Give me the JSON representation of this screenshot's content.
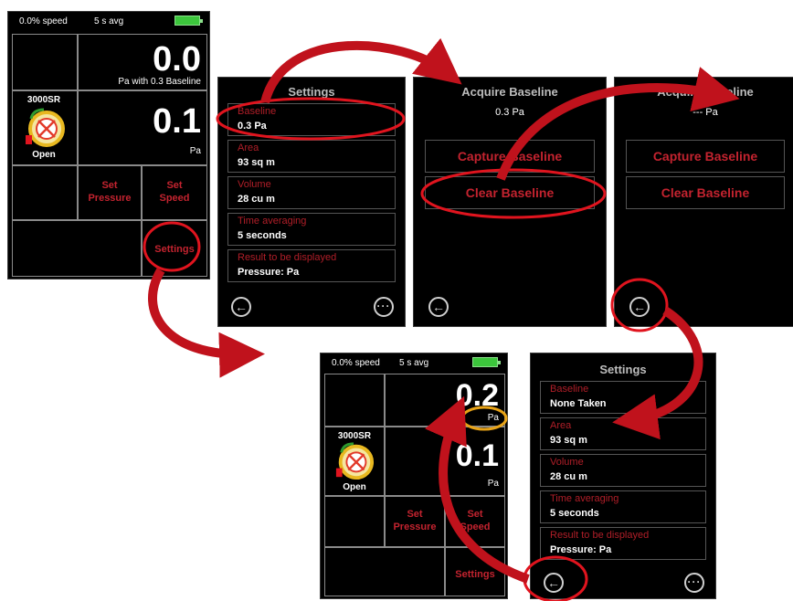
{
  "main_top": {
    "speed": "0.0% speed",
    "avg": "5 s avg",
    "top_value": "0.0",
    "top_unit": "Pa with 0.3  Baseline",
    "model": "3000SR",
    "state": "Open",
    "bottom_value": "0.1",
    "bottom_unit": "Pa",
    "set_pressure": [
      "Set",
      "Pressure"
    ],
    "set_speed": [
      "Set",
      "Speed"
    ],
    "settings": "Settings"
  },
  "settings_1": {
    "title": "Settings",
    "fields": [
      {
        "label": "Baseline",
        "value": "0.3 Pa"
      },
      {
        "label": "Area",
        "value": "93 sq m"
      },
      {
        "label": "Volume",
        "value": "28 cu m"
      },
      {
        "label": "Time averaging",
        "value": "5 seconds"
      },
      {
        "label": "Result to be displayed",
        "value": "Pressure: Pa"
      }
    ]
  },
  "acquire_1": {
    "title": "Acquire Baseline",
    "value": "0.3 Pa",
    "capture": "Capture Baseline",
    "clear": "Clear Baseline"
  },
  "acquire_2": {
    "title": "Acquire Baseline",
    "value": "--- Pa",
    "capture": "Capture Baseline",
    "clear": "Clear Baseline"
  },
  "main_bottom": {
    "speed": "0.0% speed",
    "avg": "5 s avg",
    "top_value": "0.2",
    "top_unit": "Pa",
    "model": "3000SR",
    "state": "Open",
    "bottom_value": "0.1",
    "bottom_unit": "Pa",
    "set_pressure": [
      "Set",
      "Pressure"
    ],
    "set_speed": [
      "Set",
      "Speed"
    ],
    "settings": "Settings"
  },
  "settings_2": {
    "title": "Settings",
    "fields": [
      {
        "label": "Baseline",
        "value": "None Taken"
      },
      {
        "label": "Area",
        "value": "93 sq m"
      },
      {
        "label": "Volume",
        "value": "28 cu m"
      },
      {
        "label": "Time averaging",
        "value": "5 seconds"
      },
      {
        "label": "Result to be displayed",
        "value": "Pressure: Pa"
      }
    ]
  },
  "icons": {
    "back": "back-arrow-icon",
    "more": "more-dots-icon",
    "fan": "fan-icon"
  },
  "colors": {
    "accent_red": "#c3232f",
    "annotation_red": "#e0141e",
    "highlight_yellow": "#e8a317",
    "battery": "#3cc63c"
  }
}
